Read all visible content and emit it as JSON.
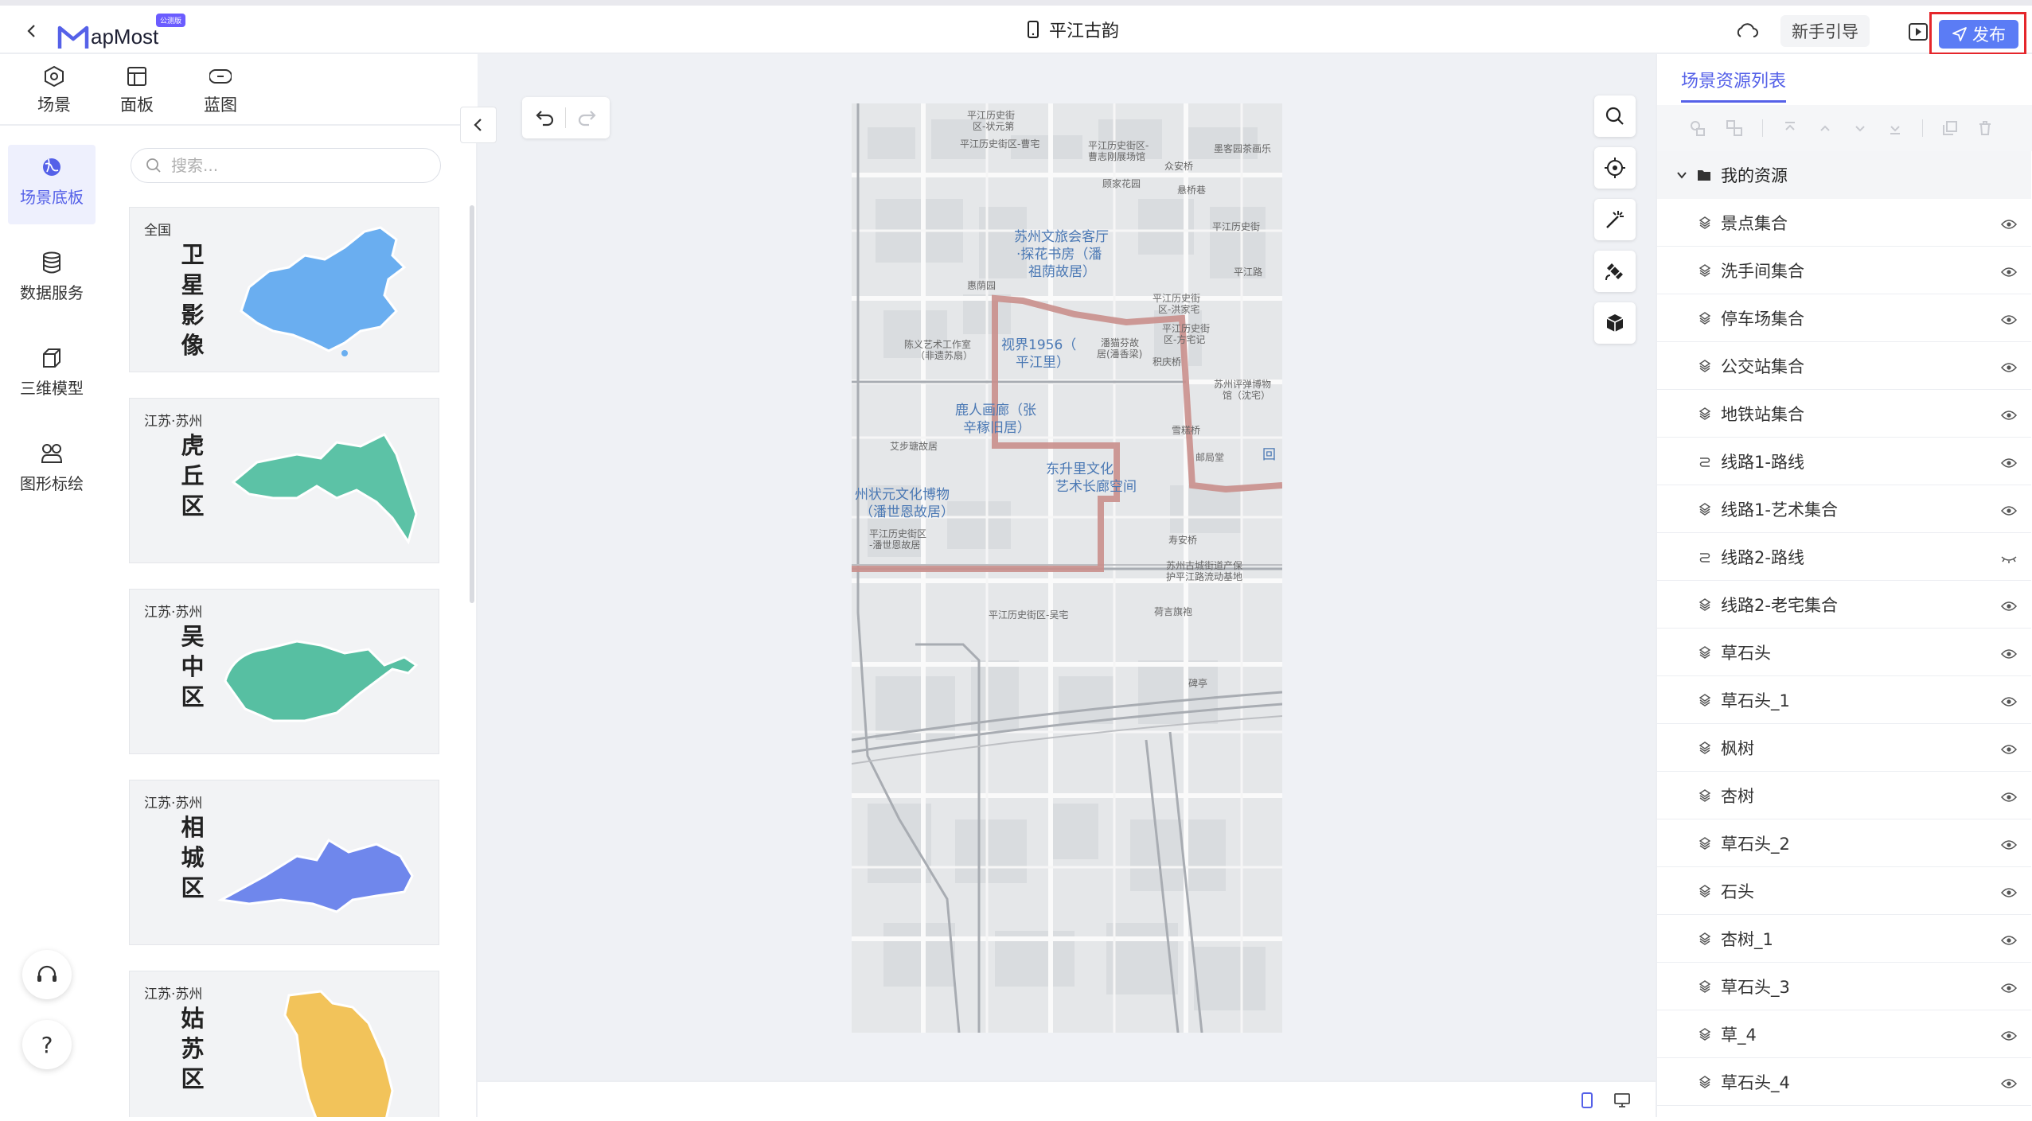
{
  "topbar": {
    "logo_text": "apMost",
    "logo_badge": "公测版",
    "title": "平江古韵",
    "guide_label": "新手引导",
    "publish_label": "发布"
  },
  "left_tabs": [
    {
      "label": "场景",
      "icon": "scene-icon",
      "active": true
    },
    {
      "label": "面板",
      "icon": "panel-icon",
      "active": false
    },
    {
      "label": "蓝图",
      "icon": "blueprint-icon",
      "active": false
    }
  ],
  "rail": [
    {
      "label": "场景底板",
      "icon": "globe-icon",
      "active": true
    },
    {
      "label": "数据服务",
      "icon": "database-icon",
      "active": false
    },
    {
      "label": "三维模型",
      "icon": "cube-icon",
      "active": false
    },
    {
      "label": "图形标绘",
      "icon": "shapes-icon",
      "active": false
    }
  ],
  "search": {
    "placeholder": "搜索..."
  },
  "base_cards": [
    {
      "region": "全国",
      "name": "卫星影像",
      "color": "#6aaef0"
    },
    {
      "region": "江苏·苏州",
      "name": "虎丘区",
      "color": "#5cc2a6"
    },
    {
      "region": "江苏·苏州",
      "name": "吴中区",
      "color": "#57bfa2"
    },
    {
      "region": "江苏·苏州",
      "name": "相城区",
      "color": "#6f87ec"
    },
    {
      "region": "江苏·苏州",
      "name": "姑苏区",
      "color": "#f2c35a"
    }
  ],
  "map": {
    "blue_labels": [
      "苏州文旅会客厅",
      "·探花书房（潘",
      "祖荫故居）",
      "视界1956（",
      "平江里）",
      "鹿人画廊（张",
      "辛稼旧居）",
      "东升里文化",
      "艺术长廊空间",
      "州状元文化博物",
      "（潘世恩故居）",
      "回"
    ],
    "gray_labels": [
      "平江历史街",
      "区-状元第",
      "平江历史街区-曹宅",
      "平江历史街区-",
      "曹志刚展场馆",
      "众安桥",
      "墨客园茶画乐",
      "顾家花园",
      "悬桥巷",
      "平江历史街",
      "惠荫园",
      "平江路",
      "平江历史街",
      "区-洪家宅",
      "陈义艺术工作室",
      "（非遗苏扇）",
      "潘猫芬故",
      "居(潘香梁)",
      "平江历史街",
      "区-方宅记",
      "积庆桥",
      "苏州评弹博物",
      "馆（沈宅）",
      "艾步瑭故居",
      "雪糕桥",
      "邮局堂",
      "平江历史街区",
      "-潘世恩故居",
      "寿安桥",
      "苏州古城街道产保",
      "护平江路流动基地",
      "平江历史街区-吴宅",
      "荷言旗袍",
      "碑亭"
    ]
  },
  "resources": {
    "title": "场景资源列表",
    "root_label": "我的资源",
    "items": [
      {
        "label": "景点集合",
        "icon": "layer-icon",
        "visible": true
      },
      {
        "label": "洗手间集合",
        "icon": "layer-icon",
        "visible": true
      },
      {
        "label": "停车场集合",
        "icon": "layer-icon",
        "visible": true
      },
      {
        "label": "公交站集合",
        "icon": "layer-icon",
        "visible": true
      },
      {
        "label": "地铁站集合",
        "icon": "layer-icon",
        "visible": true
      },
      {
        "label": "线路1-路线",
        "icon": "route-icon",
        "visible": true
      },
      {
        "label": "线路1-艺术集合",
        "icon": "layer-icon",
        "visible": true
      },
      {
        "label": "线路2-路线",
        "icon": "route-icon",
        "visible": false
      },
      {
        "label": "线路2-老宅集合",
        "icon": "layer-icon",
        "visible": true
      },
      {
        "label": "草石头",
        "icon": "layer-icon",
        "visible": true
      },
      {
        "label": "草石头_1",
        "icon": "layer-icon",
        "visible": true
      },
      {
        "label": "枫树",
        "icon": "layer-icon",
        "visible": true
      },
      {
        "label": "杏树",
        "icon": "layer-icon",
        "visible": true
      },
      {
        "label": "草石头_2",
        "icon": "layer-icon",
        "visible": true
      },
      {
        "label": "石头",
        "icon": "layer-icon",
        "visible": true
      },
      {
        "label": "杏树_1",
        "icon": "layer-icon",
        "visible": true
      },
      {
        "label": "草石头_3",
        "icon": "layer-icon",
        "visible": true
      },
      {
        "label": "草_4",
        "icon": "layer-icon",
        "visible": true
      },
      {
        "label": "草石头_4",
        "icon": "layer-icon",
        "visible": true
      }
    ]
  },
  "colors": {
    "accent": "#5561e8",
    "publish": "#5b7cf5",
    "highlight_border": "#e5262b",
    "route": "#c98f8c"
  }
}
